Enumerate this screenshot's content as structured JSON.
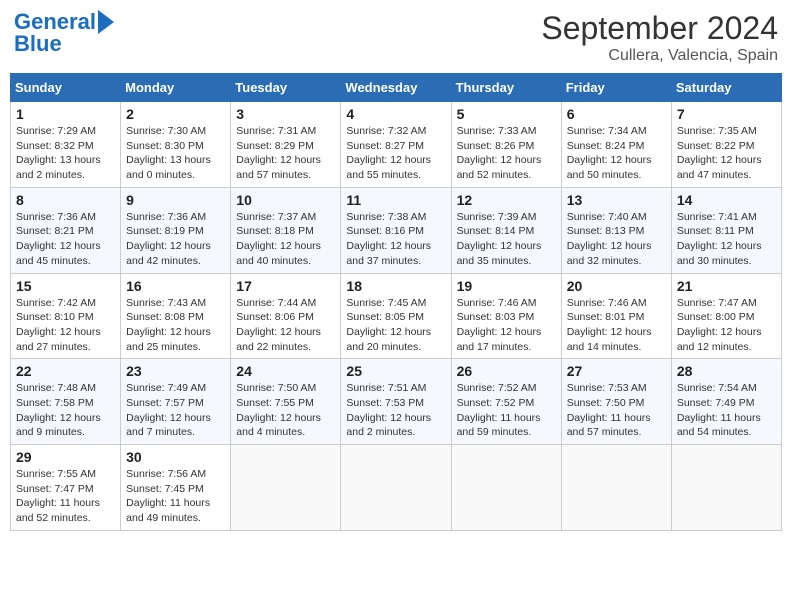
{
  "header": {
    "logo_line1": "General",
    "logo_line2": "Blue",
    "title": "September 2024",
    "subtitle": "Cullera, Valencia, Spain"
  },
  "calendar": {
    "columns": [
      "Sunday",
      "Monday",
      "Tuesday",
      "Wednesday",
      "Thursday",
      "Friday",
      "Saturday"
    ],
    "weeks": [
      [
        null,
        {
          "day": "2",
          "sunrise": "7:30 AM",
          "sunset": "8:30 PM",
          "daylight": "13 hours and 0 minutes."
        },
        {
          "day": "3",
          "sunrise": "7:31 AM",
          "sunset": "8:29 PM",
          "daylight": "12 hours and 57 minutes."
        },
        {
          "day": "4",
          "sunrise": "7:32 AM",
          "sunset": "8:27 PM",
          "daylight": "12 hours and 55 minutes."
        },
        {
          "day": "5",
          "sunrise": "7:33 AM",
          "sunset": "8:26 PM",
          "daylight": "12 hours and 52 minutes."
        },
        {
          "day": "6",
          "sunrise": "7:34 AM",
          "sunset": "8:24 PM",
          "daylight": "12 hours and 50 minutes."
        },
        {
          "day": "7",
          "sunrise": "7:35 AM",
          "sunset": "8:22 PM",
          "daylight": "12 hours and 47 minutes."
        }
      ],
      [
        {
          "day": "1",
          "sunrise": "7:29 AM",
          "sunset": "8:32 PM",
          "daylight": "13 hours and 2 minutes."
        },
        null,
        null,
        null,
        null,
        null,
        null
      ],
      [
        {
          "day": "8",
          "sunrise": "7:36 AM",
          "sunset": "8:21 PM",
          "daylight": "12 hours and 45 minutes."
        },
        {
          "day": "9",
          "sunrise": "7:36 AM",
          "sunset": "8:19 PM",
          "daylight": "12 hours and 42 minutes."
        },
        {
          "day": "10",
          "sunrise": "7:37 AM",
          "sunset": "8:18 PM",
          "daylight": "12 hours and 40 minutes."
        },
        {
          "day": "11",
          "sunrise": "7:38 AM",
          "sunset": "8:16 PM",
          "daylight": "12 hours and 37 minutes."
        },
        {
          "day": "12",
          "sunrise": "7:39 AM",
          "sunset": "8:14 PM",
          "daylight": "12 hours and 35 minutes."
        },
        {
          "day": "13",
          "sunrise": "7:40 AM",
          "sunset": "8:13 PM",
          "daylight": "12 hours and 32 minutes."
        },
        {
          "day": "14",
          "sunrise": "7:41 AM",
          "sunset": "8:11 PM",
          "daylight": "12 hours and 30 minutes."
        }
      ],
      [
        {
          "day": "15",
          "sunrise": "7:42 AM",
          "sunset": "8:10 PM",
          "daylight": "12 hours and 27 minutes."
        },
        {
          "day": "16",
          "sunrise": "7:43 AM",
          "sunset": "8:08 PM",
          "daylight": "12 hours and 25 minutes."
        },
        {
          "day": "17",
          "sunrise": "7:44 AM",
          "sunset": "8:06 PM",
          "daylight": "12 hours and 22 minutes."
        },
        {
          "day": "18",
          "sunrise": "7:45 AM",
          "sunset": "8:05 PM",
          "daylight": "12 hours and 20 minutes."
        },
        {
          "day": "19",
          "sunrise": "7:46 AM",
          "sunset": "8:03 PM",
          "daylight": "12 hours and 17 minutes."
        },
        {
          "day": "20",
          "sunrise": "7:46 AM",
          "sunset": "8:01 PM",
          "daylight": "12 hours and 14 minutes."
        },
        {
          "day": "21",
          "sunrise": "7:47 AM",
          "sunset": "8:00 PM",
          "daylight": "12 hours and 12 minutes."
        }
      ],
      [
        {
          "day": "22",
          "sunrise": "7:48 AM",
          "sunset": "7:58 PM",
          "daylight": "12 hours and 9 minutes."
        },
        {
          "day": "23",
          "sunrise": "7:49 AM",
          "sunset": "7:57 PM",
          "daylight": "12 hours and 7 minutes."
        },
        {
          "day": "24",
          "sunrise": "7:50 AM",
          "sunset": "7:55 PM",
          "daylight": "12 hours and 4 minutes."
        },
        {
          "day": "25",
          "sunrise": "7:51 AM",
          "sunset": "7:53 PM",
          "daylight": "12 hours and 2 minutes."
        },
        {
          "day": "26",
          "sunrise": "7:52 AM",
          "sunset": "7:52 PM",
          "daylight": "11 hours and 59 minutes."
        },
        {
          "day": "27",
          "sunrise": "7:53 AM",
          "sunset": "7:50 PM",
          "daylight": "11 hours and 57 minutes."
        },
        {
          "day": "28",
          "sunrise": "7:54 AM",
          "sunset": "7:49 PM",
          "daylight": "11 hours and 54 minutes."
        }
      ],
      [
        {
          "day": "29",
          "sunrise": "7:55 AM",
          "sunset": "7:47 PM",
          "daylight": "11 hours and 52 minutes."
        },
        {
          "day": "30",
          "sunrise": "7:56 AM",
          "sunset": "7:45 PM",
          "daylight": "11 hours and 49 minutes."
        },
        null,
        null,
        null,
        null,
        null
      ]
    ]
  }
}
